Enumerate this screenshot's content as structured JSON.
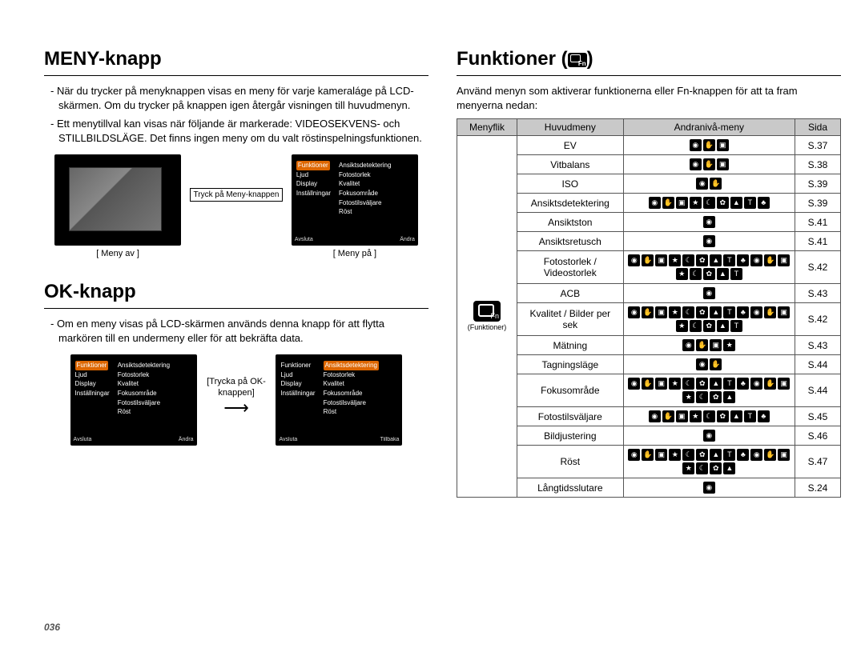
{
  "pageNumber": "036",
  "left": {
    "h_meny": "MENY-knapp",
    "p1": "- När du trycker på menyknappen visas en meny för varje kameraláge på LCD-skärmen. Om du trycker på knappen igen återgår visningen till huvudmenyn.",
    "p2": "- Ett menytillval kan visas när följande är markerade: VIDEOSEKVENS- och STILLBILDSLÄGE. Det finns ingen meny om du valt röstinspelningsfunktionen.",
    "midLabel": "Tryck på Meny-knappen",
    "cap_off": "[ Meny av ]",
    "cap_on": "[ Meny på ]",
    "menu_items_left": [
      "Funktioner",
      "Ljud",
      "Display",
      "Inställningar"
    ],
    "menu_items_right": [
      "Ansiktsdetektering",
      "Fotostorlek",
      "Kvalitet",
      "Fokusområde",
      "Fotostilsväljare",
      "Röst"
    ],
    "bot_exit": "Avsluta",
    "bot_change": "Ändra",
    "h_ok": "OK-knapp",
    "p_ok": "- Om en meny visas på LCD-skärmen används denna knapp för att flytta markören till en undermeny eller för att bekräfta data.",
    "arrow_label": "[Trycka på OK-knappen]",
    "bot_back": "Tillbaka"
  },
  "right": {
    "h_fn": "Funktioner (",
    "h_fn_close": ")",
    "p_fn": "Använd menyn som aktiverar funktionerna eller Fn-knappen för att ta fram menyerna nedan:",
    "th1": "Menyflik",
    "th2": "Huvudmeny",
    "th3": "Andranivå-meny",
    "th4": "Sida",
    "flik_label": "(Funktioner)",
    "rows": [
      {
        "name": "EV",
        "icons": 3,
        "page": "S.37"
      },
      {
        "name": "Vitbalans",
        "icons": 3,
        "page": "S.38"
      },
      {
        "name": "ISO",
        "icons": 2,
        "page": "S.39"
      },
      {
        "name": "Ansiktsdetektering",
        "icons": 9,
        "page": "S.39"
      },
      {
        "name": "Ansiktston",
        "icons": 1,
        "page": "S.41"
      },
      {
        "name": "Ansiktsretusch",
        "icons": 1,
        "page": "S.41"
      },
      {
        "name": "Fotostorlek / Videostorlek",
        "icons": 17,
        "page": "S.42"
      },
      {
        "name": "ACB",
        "icons": 1,
        "page": "S.43"
      },
      {
        "name": "Kvalitet / Bilder per sek",
        "icons": 17,
        "page": "S.42"
      },
      {
        "name": "Mätning",
        "icons": 4,
        "page": "S.43"
      },
      {
        "name": "Tagningsläge",
        "icons": 2,
        "page": "S.44"
      },
      {
        "name": "Fokusområde",
        "icons": 16,
        "page": "S.44"
      },
      {
        "name": "Fotostilsväljare",
        "icons": 9,
        "page": "S.45"
      },
      {
        "name": "Bildjustering",
        "icons": 1,
        "page": "S.46"
      },
      {
        "name": "Röst",
        "icons": 16,
        "page": "S.47"
      },
      {
        "name": "Långtidsslutare",
        "icons": 1,
        "page": "S.24"
      }
    ]
  }
}
